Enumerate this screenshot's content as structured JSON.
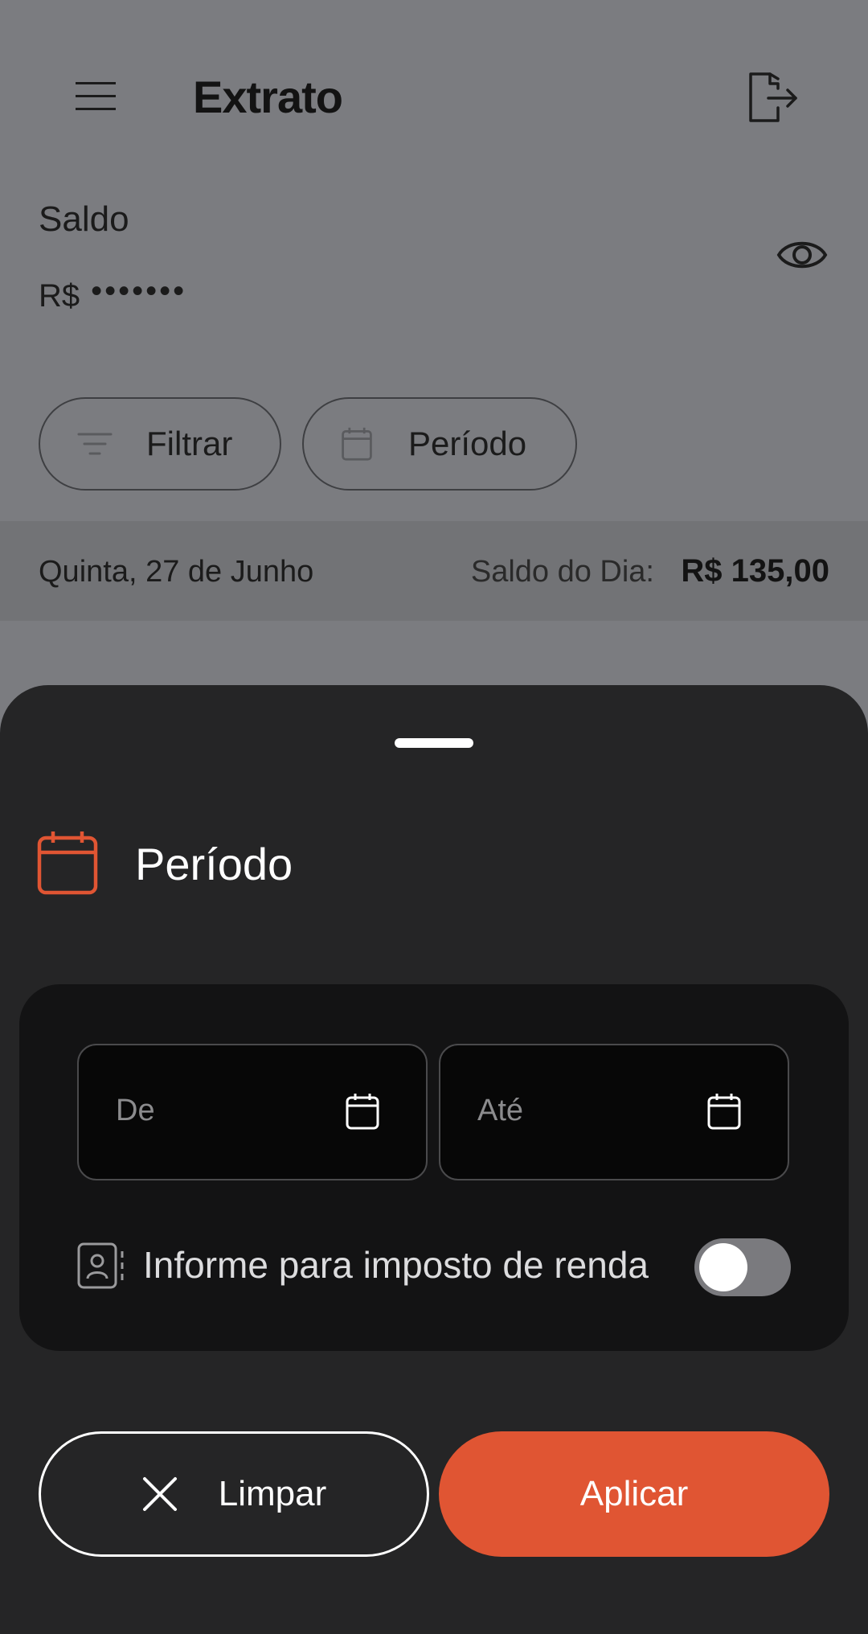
{
  "header": {
    "title": "Extrato"
  },
  "balance": {
    "label": "Saldo",
    "currency": "R$",
    "masked_value": "•••••••"
  },
  "chips": {
    "filter_label": "Filtrar",
    "period_label": "Período"
  },
  "day": {
    "date": "Quinta, 27 de Junho",
    "saldo_label": "Saldo do Dia:",
    "saldo_value": "R$ 135,00"
  },
  "sheet": {
    "title": "Período",
    "from_placeholder": "De",
    "to_placeholder": "Até",
    "income_tax_label": "Informe para imposto de renda",
    "income_tax_enabled": false,
    "clear_label": "Limpar",
    "apply_label": "Aplicar"
  },
  "colors": {
    "accent": "#e05533",
    "sheet_bg": "#252526",
    "overlay_bg": "#7b7c80"
  },
  "icons": [
    "menu-icon",
    "logout-icon",
    "eye-icon",
    "filter-icon",
    "calendar-icon",
    "contact-card-icon",
    "close-icon"
  ]
}
